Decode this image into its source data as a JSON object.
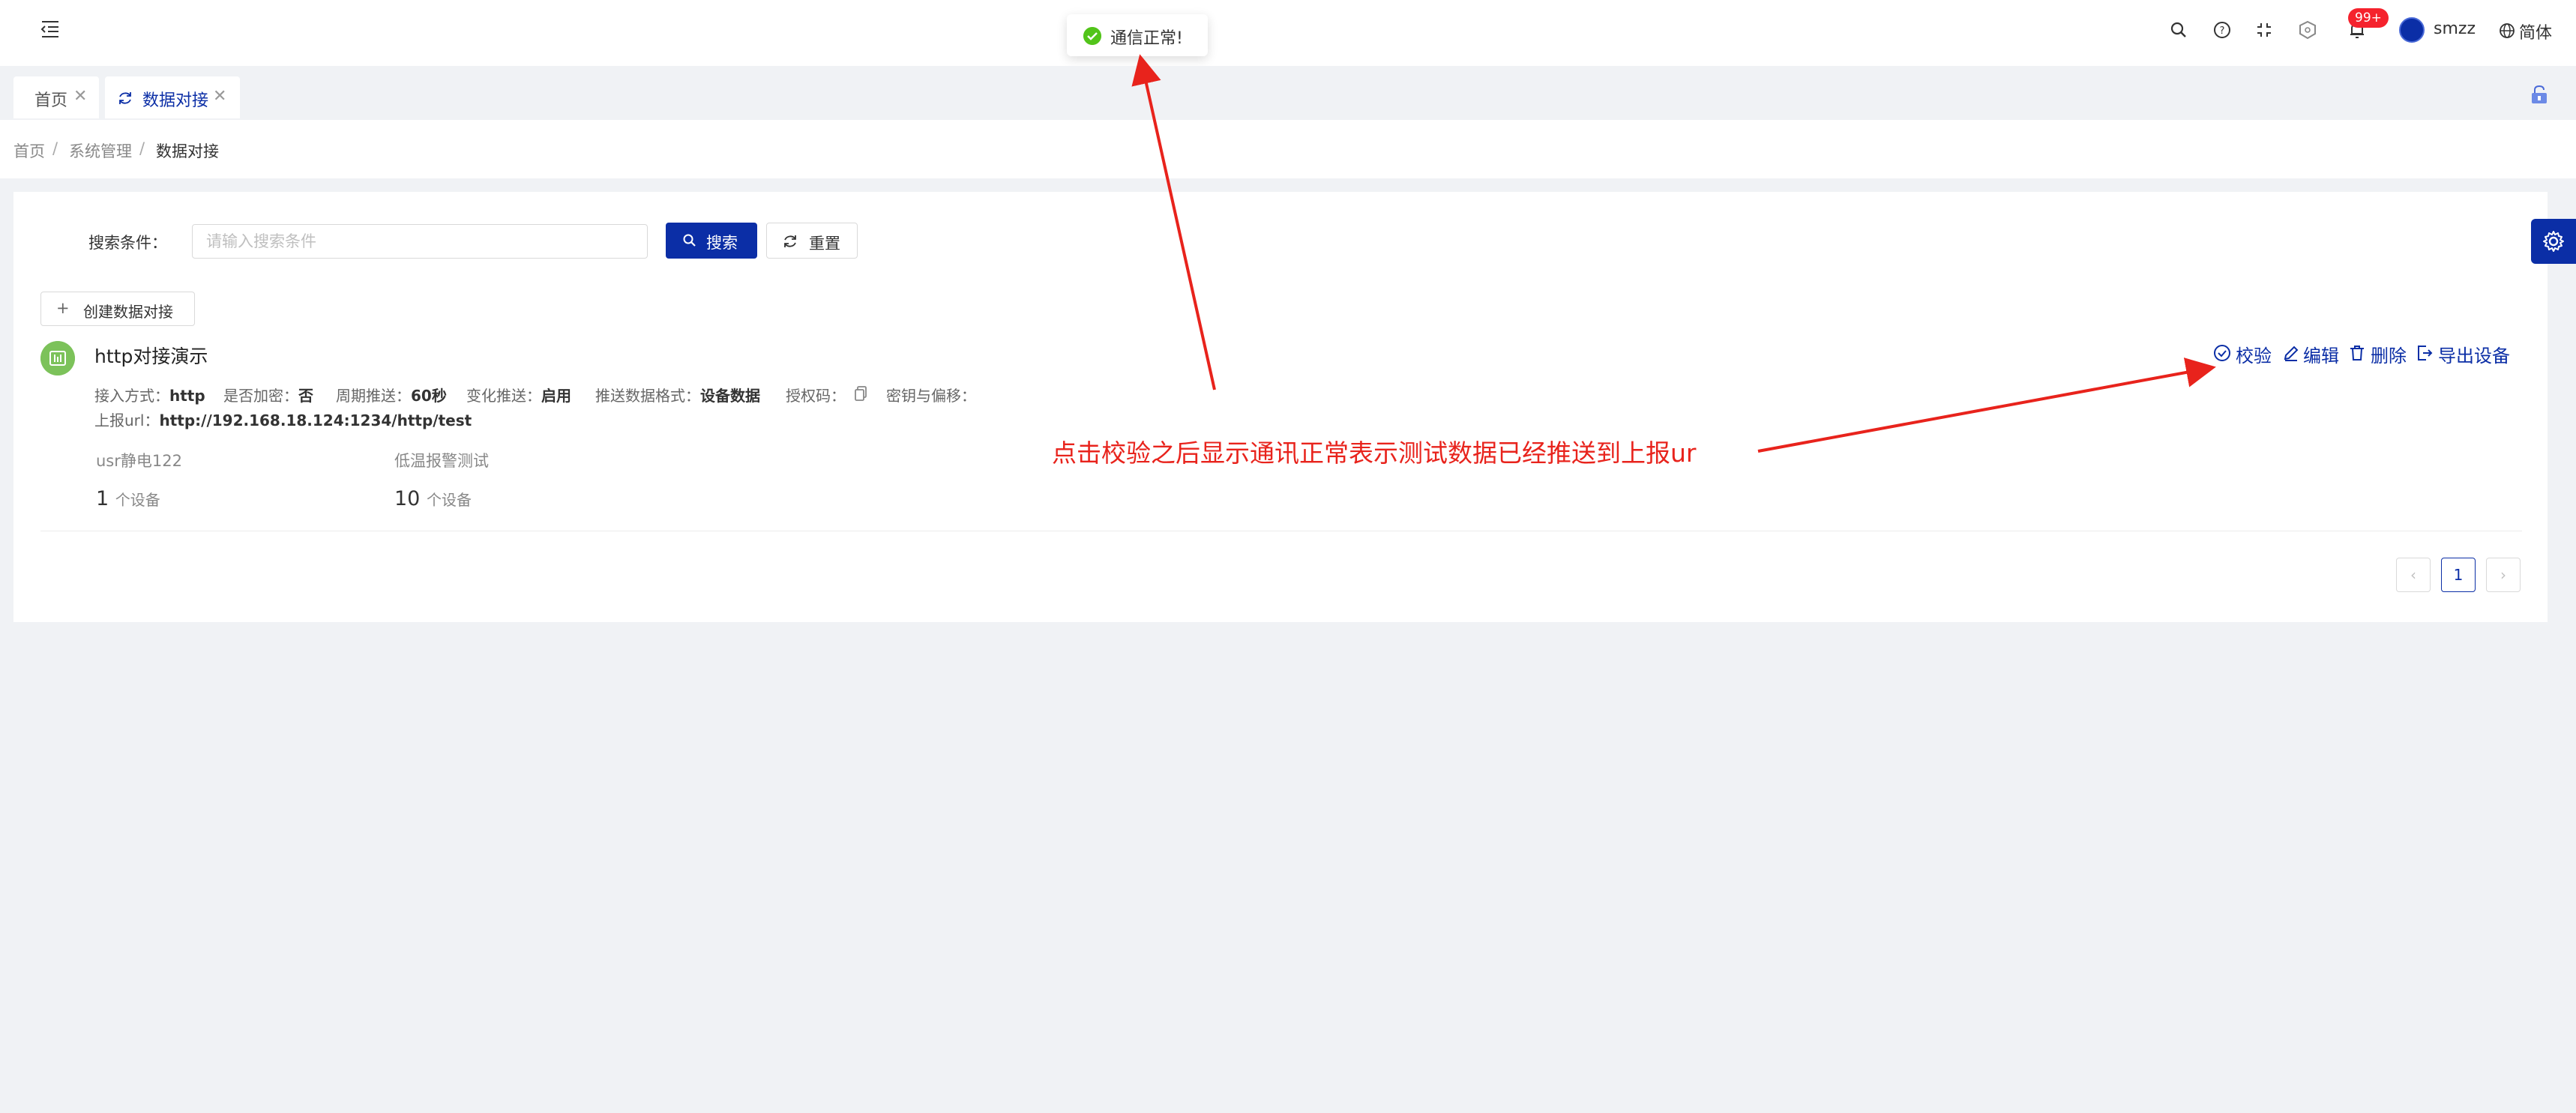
{
  "header": {
    "username": "smzz",
    "language": "简体",
    "notification_badge": "99+",
    "icons": [
      "menu-fold-icon",
      "search-icon",
      "help-icon",
      "fullscreen-icon",
      "shield-icon",
      "bell-icon",
      "globe-icon"
    ]
  },
  "toast": {
    "message": "通信正常!"
  },
  "tabs": [
    {
      "label": "首页",
      "active": false
    },
    {
      "label": "数据对接",
      "active": true
    }
  ],
  "breadcrumb": [
    "首页",
    "系统管理",
    "数据对接"
  ],
  "breadcrumb_separator": "/",
  "search": {
    "label": "搜索条件：",
    "placeholder": "请输入搜索条件",
    "search_button": "搜索",
    "reset_button": "重置"
  },
  "create_button": "创建数据对接",
  "item": {
    "title": "http对接演示",
    "access_label": "接入方式：",
    "access_value": "http",
    "encrypt_label": "是否加密：",
    "encrypt_value": "否",
    "period_label": "周期推送：",
    "period_value": "60秒",
    "change_label": "变化推送：",
    "change_value": "启用",
    "format_label": "推送数据格式：",
    "format_value": "设备数据",
    "auth_label": "授权码：",
    "key_label": "密钥与偏移：",
    "url_label": "上报url：",
    "url_value": "http://192.168.18.124:1234/http/test",
    "actions": {
      "verify": "校验",
      "edit": "编辑",
      "delete": "删除",
      "export": "导出设备"
    },
    "groups": [
      {
        "name": "usr静电122",
        "count": "1",
        "unit": "个设备"
      },
      {
        "name": "低温报警测试",
        "count": "10",
        "unit": "个设备"
      }
    ]
  },
  "pagination": {
    "current": "1"
  },
  "annotation": {
    "text": "点击校验之后显示通讯正常表示测试数据已经推送到上报ur",
    "color": "#e8231c"
  },
  "colors": {
    "primary": "#0b2ea6",
    "success": "#52c41a",
    "danger": "#f5222d",
    "item_icon": "#7cc25a"
  }
}
